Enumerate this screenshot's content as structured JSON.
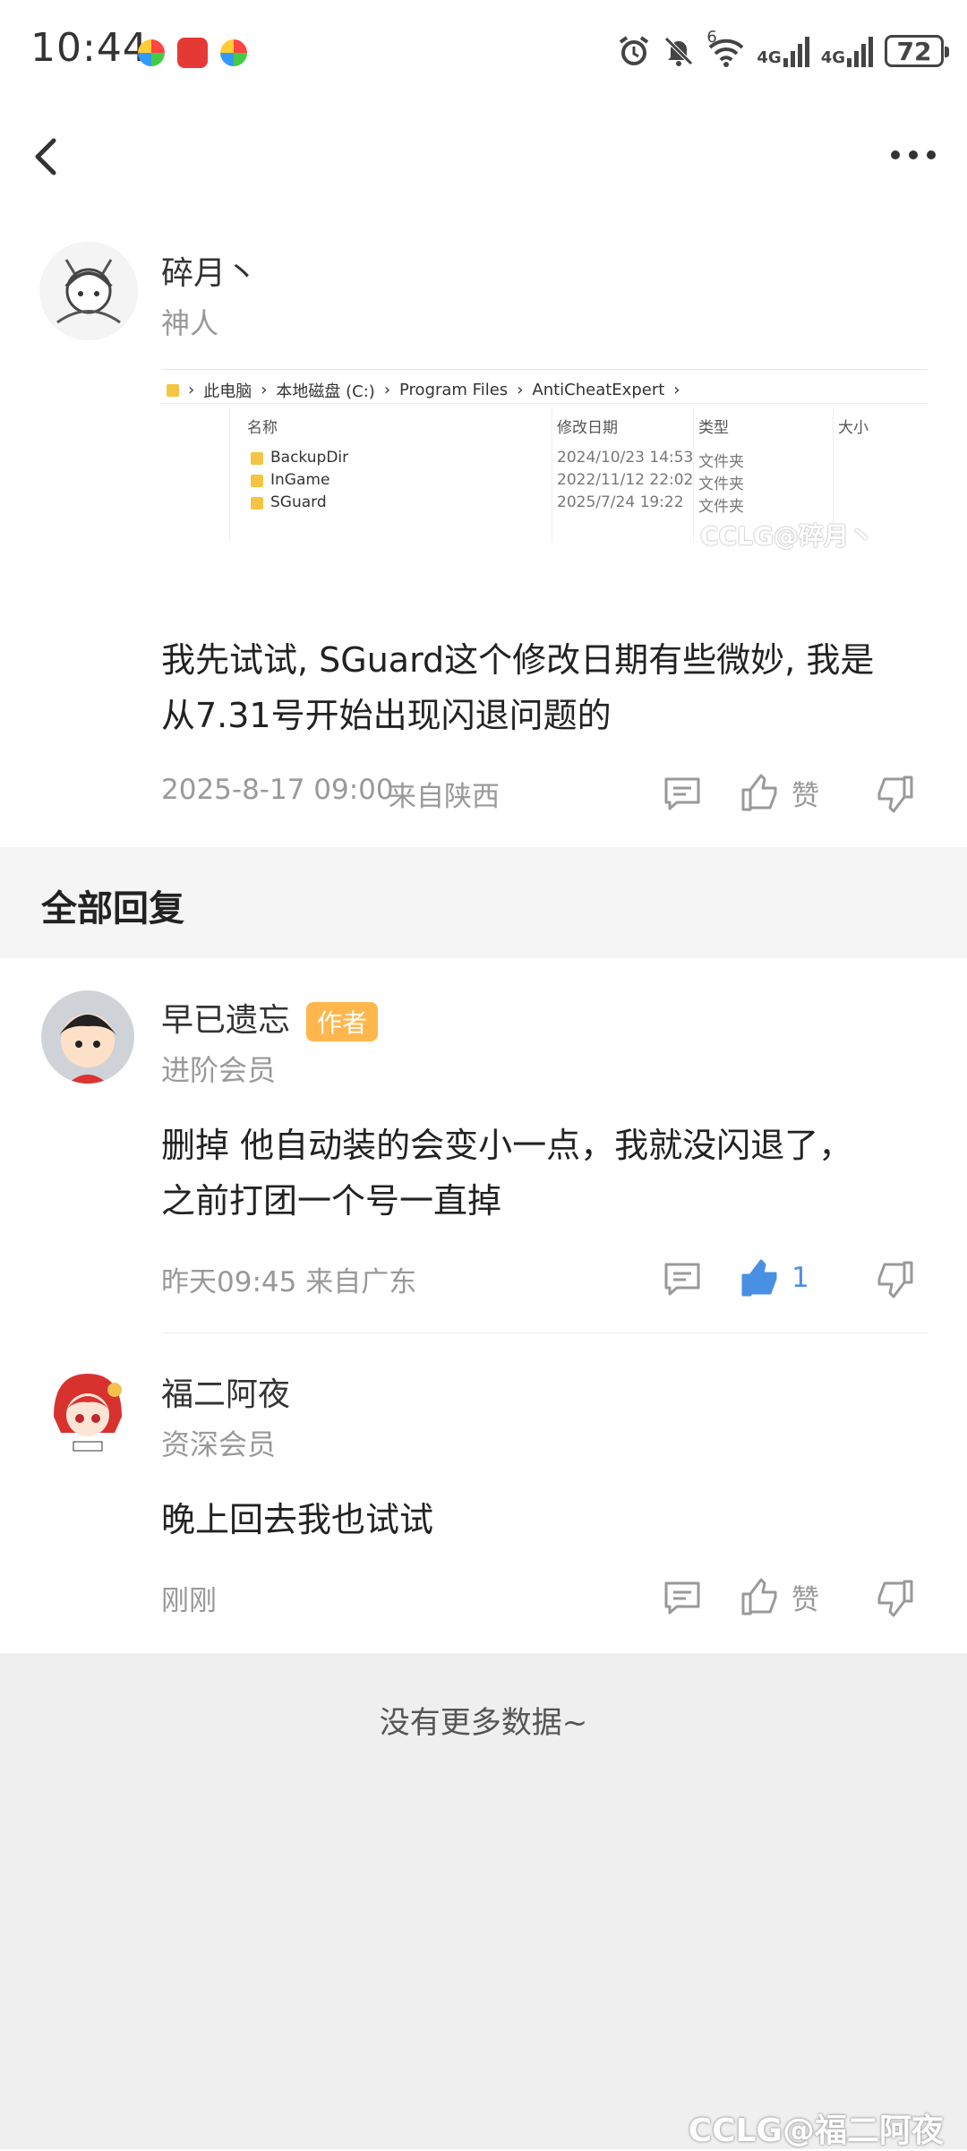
{
  "status_bar": {
    "time": "10:44",
    "signal1": "4G",
    "signal2": "4G",
    "wifi_sup": "6",
    "battery": "72"
  },
  "post": {
    "author": "碎月丶",
    "level": "神人",
    "screenshot": {
      "path": [
        "此电脑",
        "本地磁盘 (C:)",
        "Program Files",
        "AntiCheatExpert"
      ],
      "columns": [
        "名称",
        "修改日期",
        "类型",
        "大小"
      ],
      "rows": [
        {
          "name": "BackupDir",
          "date": "2024/10/23 14:53",
          "type": "文件夹"
        },
        {
          "name": "InGame",
          "date": "2022/11/12 22:02",
          "type": "文件夹"
        },
        {
          "name": "SGuard",
          "date": "2025/7/24 19:22",
          "type": "文件夹"
        }
      ],
      "watermark": "CCLG@碎月丶"
    },
    "text_line1": "我先试试, SGuard这个修改日期有些微妙, 我是",
    "text_line2": "从7.31号开始出现闪退问题的",
    "time": "2025-8-17 09:00",
    "location": "来自陕西",
    "like_label": "赞"
  },
  "section_title": "全部回复",
  "replies": [
    {
      "author": "早已遗忘",
      "badge": "作者",
      "level": "进阶会员",
      "text_line1": "删掉  他自动装的会变小一点，我就没闪退了，",
      "text_line2": "之前打团一个号一直掉",
      "time": "昨天09:45 来自广东",
      "like_count": "1"
    },
    {
      "author": "福二阿夜",
      "level": "资深会员",
      "text_line1": "晚上回去我也试试",
      "time": "刚刚",
      "like_label": "赞"
    }
  ],
  "footer": {
    "no_more": "没有更多数据~",
    "watermark": "CCLG@福二阿夜"
  },
  "colors": {
    "accent_blue": "#4a90e2",
    "badge_orange": "#ffb74d"
  }
}
